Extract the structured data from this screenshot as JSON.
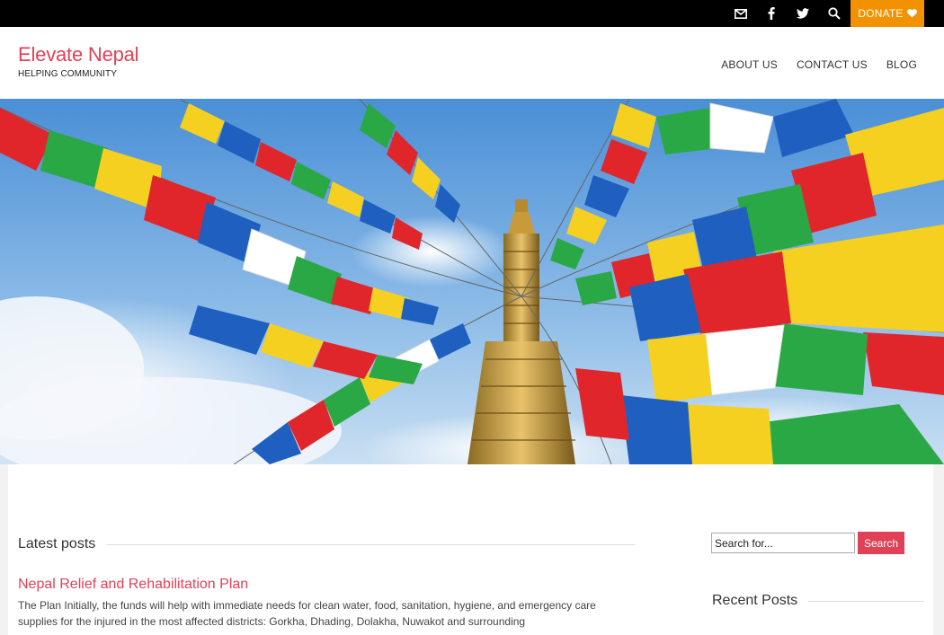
{
  "topbar": {
    "icons": [
      "mail-icon",
      "facebook-icon",
      "twitter-icon",
      "search-icon"
    ],
    "donate_label": "DONATE",
    "donate_color": "#f39200"
  },
  "header": {
    "site_title": "Elevate Nepal",
    "tagline": "HELPING COMMUNITY",
    "nav": [
      {
        "label": "ABOUT US"
      },
      {
        "label": "CONTACT US"
      },
      {
        "label": "BLOG"
      }
    ],
    "accent_color": "#e04156"
  },
  "hero": {
    "description": "Buddhist prayer flags strung over a stupa spire against a blue sky"
  },
  "main": {
    "latest_posts_heading": "Latest posts",
    "posts": [
      {
        "title": "Nepal Relief and Rehabilitation Plan",
        "excerpt": "The Plan Initially, the funds will help with immediate needs for clean water, food, sanitation, hygiene, and emergency care supplies for the injured in the most affected districts: Gorkha, Dhading, Dolakha, Nuwakot and surrounding"
      }
    ]
  },
  "sidebar": {
    "search_placeholder": "Search for...",
    "search_button": "Search",
    "recent_posts_heading": "Recent Posts"
  }
}
